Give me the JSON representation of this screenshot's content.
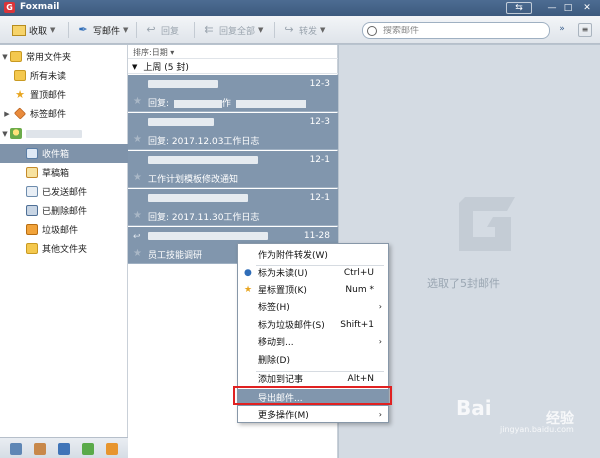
{
  "window": {
    "title": "Foxmail"
  },
  "toolbar": {
    "receive": "收取",
    "compose": "写邮件",
    "reply": "回复",
    "reply_all": "回复全部",
    "forward": "转发",
    "search_placeholder": "搜索邮件"
  },
  "sidebar": {
    "common_folders": "常用文件夹",
    "unread": "所有未读",
    "starred": "置顶邮件",
    "tagged": "标签邮件",
    "inbox": "收件箱",
    "drafts": "草稿箱",
    "sent": "已发送邮件",
    "deleted": "已删除邮件",
    "junk": "垃圾邮件",
    "other": "其他文件夹"
  },
  "list": {
    "sort_label": "排序:日期",
    "group_label": "上周 (5 封)",
    "messages": [
      {
        "date": "12-3",
        "subject_prefix": "回复:",
        "subject_tail": "作"
      },
      {
        "date": "12-3",
        "subject_prefix": "回复: 2017.12.03工作日志",
        "subject_tail": ""
      },
      {
        "date": "12-1",
        "subject_prefix": "工作计划模板修改通知",
        "subject_tail": ""
      },
      {
        "date": "12-1",
        "subject_prefix": "回复: 2017.11.30工作日志",
        "subject_tail": ""
      },
      {
        "date": "11-28",
        "subject_prefix": "员工技能调研",
        "subject_tail": ""
      }
    ]
  },
  "preview": {
    "selected_text": "选取了5封邮件"
  },
  "context_menu": {
    "forward_attachment": "作为附件转发(W)",
    "mark_unread": "标为未读(U)",
    "mark_unread_sc": "Ctrl+U",
    "star_pin": "星标置顶(K)",
    "star_pin_sc": "Num *",
    "tag": "标签(H)",
    "mark_junk": "标为垃圾邮件(S)",
    "mark_junk_sc": "Shift+1",
    "move_to": "移动到...",
    "delete": "删除(D)",
    "add_note": "添加到记事",
    "add_note_sc": "Alt+N",
    "export": "导出邮件...",
    "more": "更多操作(M)"
  },
  "watermark": {
    "brand": "Bai",
    "sub": "jingyan.baidu.com",
    "tail": "经验"
  },
  "colors": {
    "selection": "#8196ad",
    "highlight_box": "#e02121",
    "titlebar": "#3d5a7e"
  }
}
